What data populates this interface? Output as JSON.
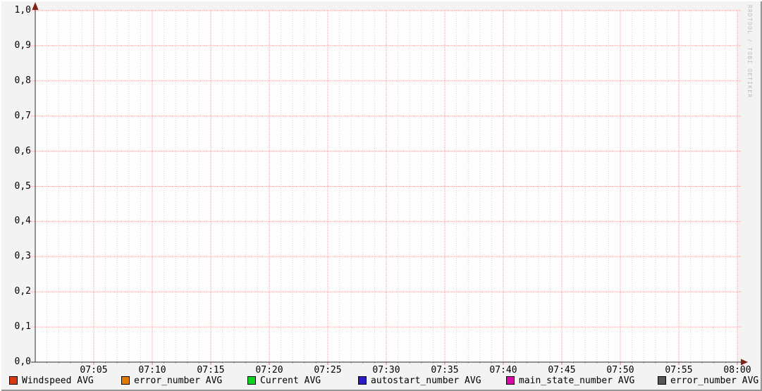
{
  "watermark": "RRDTOOL / TOBI OETIKER",
  "colors": {
    "background": "#f3f3f3",
    "canvas": "#fdfdfd",
    "major_grid": "#ef9e9e",
    "minor_grid": "#d4d4d4",
    "axis": "#2e2e2e",
    "arrow": "#801f14",
    "bevel_light": "#ffffff",
    "bevel_dark": "#969696",
    "watermark_text": "#bdbdbd"
  },
  "chart_data": {
    "type": "line",
    "title": "",
    "xlabel": "",
    "ylabel": "",
    "grid": "on",
    "legend_position": "bottom",
    "x_axis": {
      "start": "07:00",
      "end": "08:00",
      "major_step_minutes": 5,
      "minor_step_minutes": 1,
      "ticks": [
        "07:05",
        "07:10",
        "07:15",
        "07:20",
        "07:25",
        "07:30",
        "07:35",
        "07:40",
        "07:45",
        "07:50",
        "07:55",
        "08:00"
      ]
    },
    "y_axis": {
      "min": 0.0,
      "max": 1.0,
      "step": 0.1,
      "decimal_separator": ",",
      "ticks": [
        "1,0",
        "0,9",
        "0,8",
        "0,7",
        "0,6",
        "0,5",
        "0,4",
        "0,3",
        "0,2",
        "0,1",
        "0,0"
      ]
    },
    "series": [
      {
        "name": "Windspeed AVG",
        "color": "#d8380e",
        "values": []
      },
      {
        "name": "error_number AVG",
        "color": "#e07d00",
        "values": []
      },
      {
        "name": "Current AVG",
        "color": "#0fd41f",
        "values": []
      },
      {
        "name": "autostart_number AVG",
        "color": "#2b1ac9",
        "values": []
      },
      {
        "name": "main_state_number AVG",
        "color": "#d60aa6",
        "values": []
      },
      {
        "name": "error_number AVG",
        "color": "#575757",
        "values": []
      }
    ],
    "plotted_data_visible": false
  }
}
